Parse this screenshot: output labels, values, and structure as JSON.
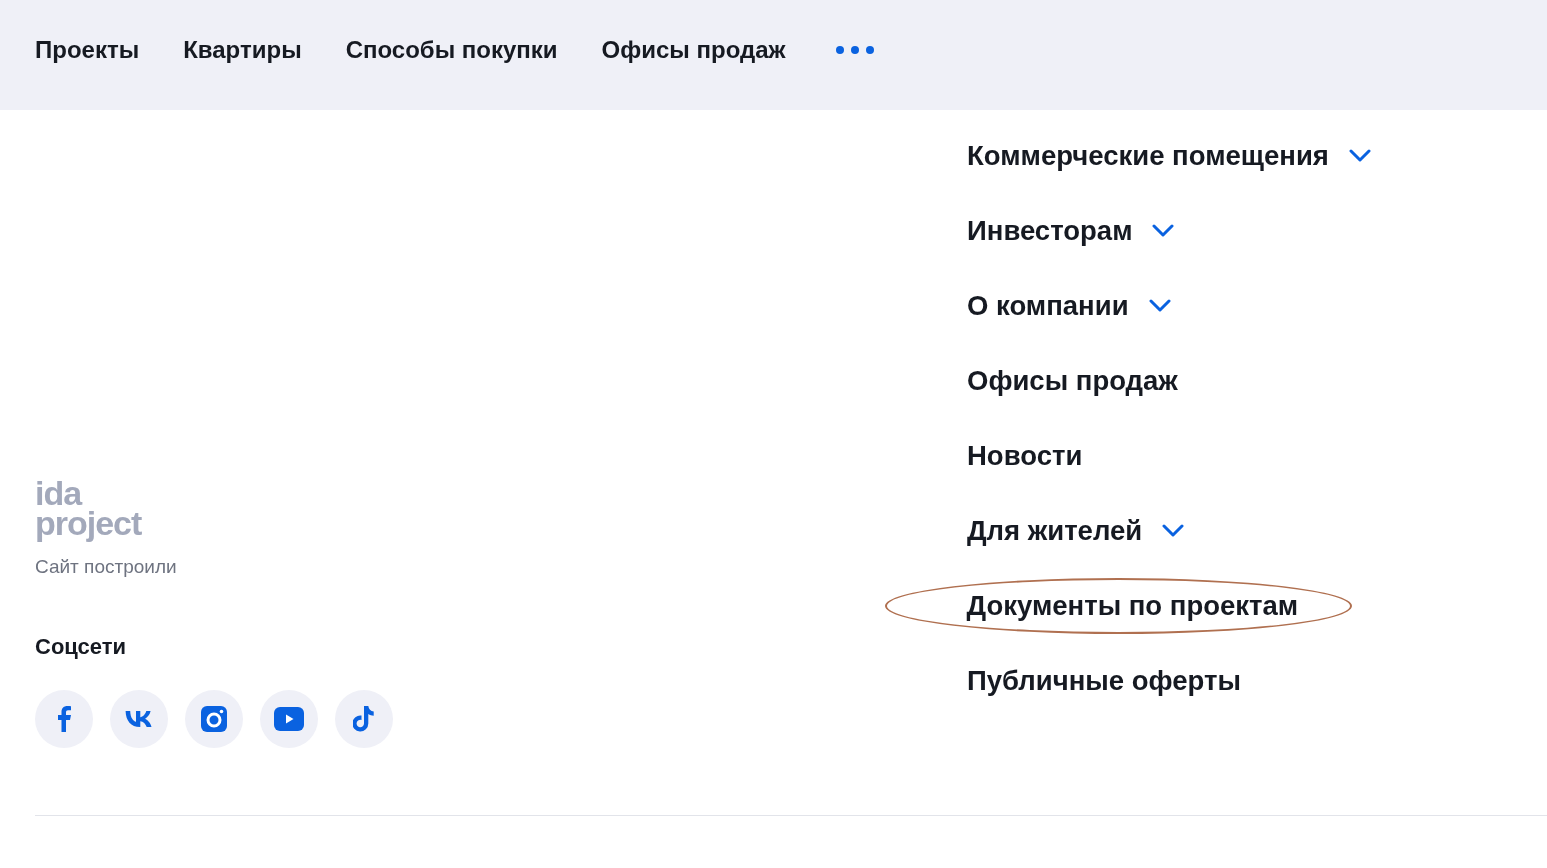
{
  "top_nav": {
    "items": [
      {
        "label": "Проекты"
      },
      {
        "label": "Квартиры"
      },
      {
        "label": "Способы покупки"
      },
      {
        "label": "Офисы продаж"
      }
    ],
    "more_button": true
  },
  "credits": {
    "logo": "ida project",
    "caption": "Сайт построили"
  },
  "social": {
    "title": "Соцсети",
    "links": [
      {
        "kind": "facebook"
      },
      {
        "kind": "vk"
      },
      {
        "kind": "instagram"
      },
      {
        "kind": "youtube"
      },
      {
        "kind": "tiktok"
      }
    ]
  },
  "menu": {
    "items": [
      {
        "label": "Коммерческие помещения",
        "expandable": true,
        "annotated": false
      },
      {
        "label": "Инвесторам",
        "expandable": true,
        "annotated": false
      },
      {
        "label": "О компании",
        "expandable": true,
        "annotated": false
      },
      {
        "label": "Офисы продаж",
        "expandable": false,
        "annotated": false
      },
      {
        "label": "Новости",
        "expandable": false,
        "annotated": false
      },
      {
        "label": "Для жителей",
        "expandable": true,
        "annotated": false
      },
      {
        "label": "Документы по проектам",
        "expandable": false,
        "annotated": true
      },
      {
        "label": "Публичные оферты",
        "expandable": false,
        "annotated": false
      }
    ]
  }
}
